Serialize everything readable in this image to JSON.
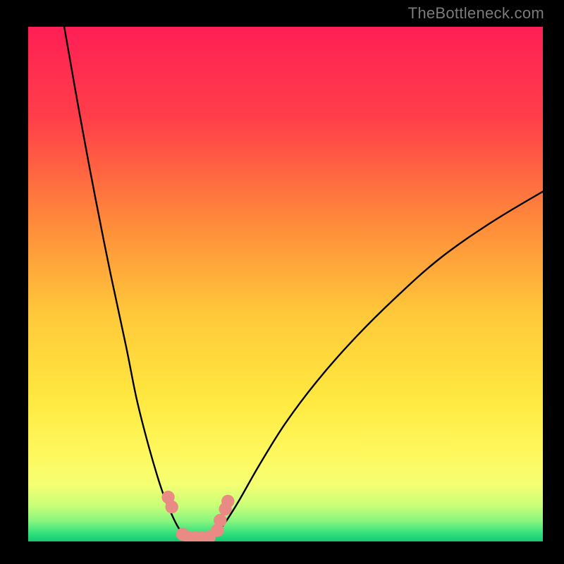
{
  "attribution": "TheBottleneck.com",
  "colors": {
    "frame": "#000000",
    "gradient_top": "#ff2050",
    "gradient_mid1": "#ff7a3a",
    "gradient_mid2": "#ffd93b",
    "gradient_mid3": "#fff960",
    "gradient_low": "#dfff70",
    "gradient_green": "#27e07a",
    "curve_stroke": "#000000",
    "marker_fill": "#e98a84"
  },
  "chart_data": {
    "type": "line",
    "title": "",
    "xlabel": "",
    "ylabel": "",
    "xlim": [
      0,
      100
    ],
    "ylim": [
      0,
      100
    ],
    "series": [
      {
        "name": "left-curve",
        "x": [
          7,
          10,
          13,
          16,
          19,
          21,
          23,
          25,
          26.5,
          28,
          29,
          30,
          30.5
        ],
        "values": [
          100,
          83,
          67,
          52,
          38,
          28,
          20,
          13,
          8.5,
          5,
          3,
          1.5,
          1
        ]
      },
      {
        "name": "right-curve",
        "x": [
          36,
          37,
          38.5,
          41,
          45,
          50,
          56,
          63,
          71,
          80,
          90,
          100
        ],
        "values": [
          1,
          2,
          4,
          8,
          15,
          23,
          31,
          39,
          47,
          55,
          62,
          68
        ]
      }
    ],
    "valley_floor": {
      "x": [
        30.5,
        31.5,
        32.5,
        33.5,
        34.5,
        36
      ],
      "values": [
        1,
        0.8,
        0.7,
        0.7,
        0.8,
        1
      ]
    },
    "markers": [
      {
        "x": 27.2,
        "y": 8.6
      },
      {
        "x": 27.9,
        "y": 6.7
      },
      {
        "x": 30.0,
        "y": 1.4
      },
      {
        "x": 31.3,
        "y": 0.7
      },
      {
        "x": 32.5,
        "y": 0.7
      },
      {
        "x": 33.7,
        "y": 0.7
      },
      {
        "x": 35.2,
        "y": 0.9
      },
      {
        "x": 36.8,
        "y": 2.2
      },
      {
        "x": 37.3,
        "y": 4.1
      },
      {
        "x": 38.3,
        "y": 6.3
      },
      {
        "x": 38.8,
        "y": 7.8
      }
    ]
  }
}
